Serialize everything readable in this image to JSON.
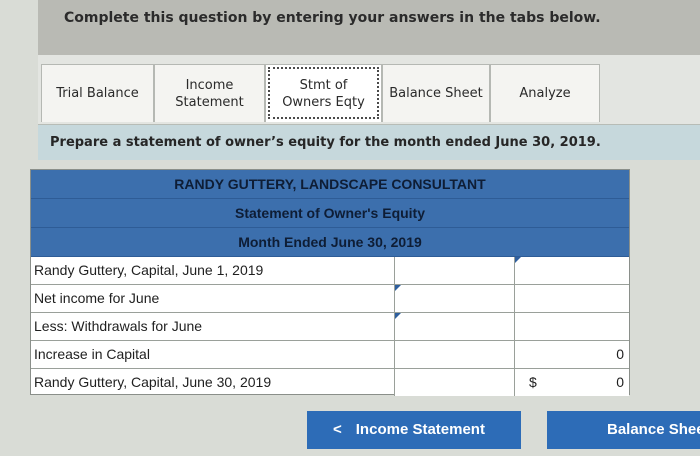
{
  "banner": {
    "text": "Complete this question by entering your answers in the tabs below."
  },
  "tabs": [
    {
      "label": "Trial Balance"
    },
    {
      "label_line1": "Income",
      "label_line2": "Statement"
    },
    {
      "label_line1": "Stmt of",
      "label_line2": "Owners Eqty"
    },
    {
      "label": "Balance Sheet"
    },
    {
      "label": "Analyze"
    }
  ],
  "instruction": "Prepare a statement of owner’s equity for the month ended June 30, 2019.",
  "statement": {
    "company": "RANDY GUTTERY, LANDSCAPE CONSULTANT",
    "title": "Statement of Owner's Equity",
    "period": "Month Ended June 30, 2019",
    "rows": [
      {
        "label": "Randy Guttery, Capital, June 1, 2019",
        "col2_value": ""
      },
      {
        "label": "Net income for June",
        "col2_value": ""
      },
      {
        "label": "Less: Withdrawals for June",
        "col2_value": ""
      },
      {
        "label": "Increase in Capital",
        "col2_value": "0"
      },
      {
        "label": "Randy Guttery, Capital, June 30, 2019",
        "col2_prefix": "$",
        "col2_value": "0"
      }
    ]
  },
  "nav": {
    "prev_icon": "chevron-left-icon",
    "prev_chevron": "<",
    "prev_label": "Income Statement",
    "next_label": "Balance Sheet"
  },
  "colors": {
    "header_blue": "#3c6fad",
    "button_blue": "#2d6cb7",
    "band_teal": "#c6d8dc"
  }
}
